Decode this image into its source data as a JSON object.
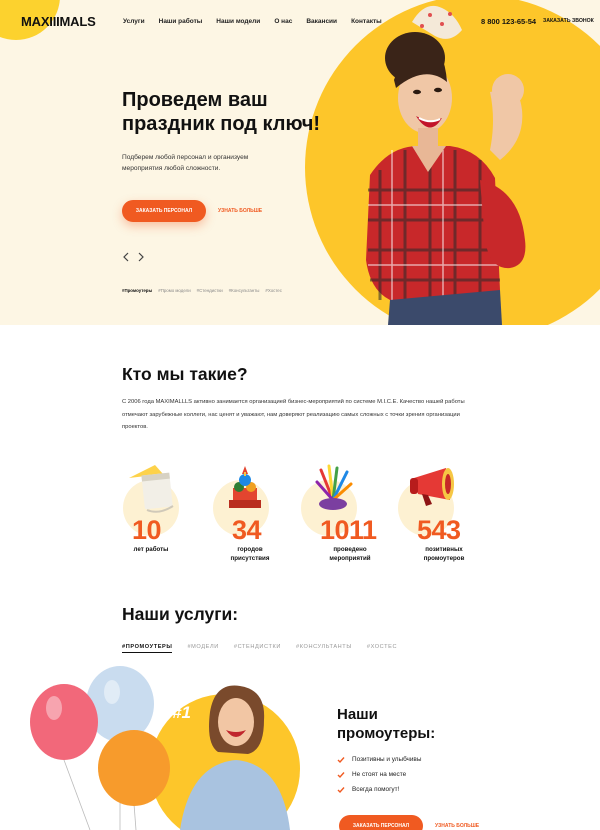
{
  "header": {
    "logo": "MAXIIIMALS",
    "nav": [
      "Услуги",
      "Наши работы",
      "Наши модели",
      "О нас",
      "Вакансии",
      "Контакты"
    ],
    "phone": "8 800 123-65-54",
    "callback_label": "заказать звонок"
  },
  "hero": {
    "title": "Проведем ваш праздник под ключ!",
    "text": "Подберем любой персонал и организуем мероприятия любой сложности.",
    "primary_button": "заказать персонал",
    "secondary_button": "узнать больше",
    "tags": [
      "#Промоутеры",
      "#Промо модели",
      "#Стендистки",
      "#Консультанты",
      "#Хостес"
    ]
  },
  "who": {
    "title": "Кто мы такие?",
    "text": "С 2006 года MAXIMALLLS активно занимается организацией бизнес-мероприятий по системе M.I.C.E. Качество нашей работы отмечают зарубежные коллеги, нас ценят и уважают, нам доверяют реализацию самых сложных с точки зрения организации проектов.",
    "stats": [
      {
        "value": "10",
        "label_1": "лет работы",
        "label_2": "",
        "icon": "calendar-icon"
      },
      {
        "value": "34",
        "label_1": "городов",
        "label_2": "присутствия",
        "icon": "kremlin-icon"
      },
      {
        "value": "1011",
        "label_1": "проведено",
        "label_2": "мероприятий",
        "icon": "fireworks-icon"
      },
      {
        "value": "543",
        "label_1": "позитивных",
        "label_2": "промоутеров",
        "icon": "megaphone-icon"
      }
    ]
  },
  "services": {
    "title": "Наши услуги:",
    "tabs": [
      "#промоутеры",
      "#модели",
      "#стендистки",
      "#консультанты",
      "#хостес"
    ],
    "card": {
      "number": "#1",
      "title_1": "Наши",
      "title_2": "промоутеры:",
      "items": [
        "Позитивны и улыбчивы",
        "Не стоят на месте",
        "Всегда помогут!"
      ],
      "primary_button": "заказать персонал",
      "secondary_button": "узнать больше"
    }
  },
  "colors": {
    "accent": "#f05a21",
    "yellow": "#fdc62a",
    "hero_bg": "#fdf6e4"
  }
}
